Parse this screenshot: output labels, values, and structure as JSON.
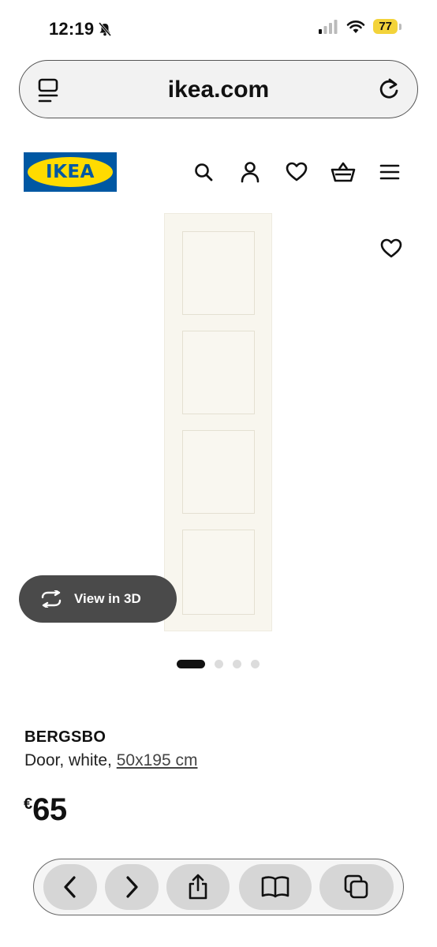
{
  "status_bar": {
    "time": "12:19",
    "battery": "77"
  },
  "browser": {
    "url": "ikea.com"
  },
  "header": {
    "logo_text": "IKEA",
    "nav_icons": [
      "search-icon",
      "account-icon",
      "heart-icon",
      "basket-icon",
      "menu-icon"
    ]
  },
  "gallery": {
    "view_3d_label": "View in 3D",
    "dot_count": 4,
    "active_dot": 1
  },
  "product": {
    "name": "BERGSBO",
    "description_prefix": "Door, white, ",
    "size_link": "50x195 cm",
    "currency": "€",
    "price": "65"
  },
  "colors": {
    "ikea_blue": "#0058a3",
    "ikea_yellow": "#ffdb00",
    "battery_yellow": "#f3d33a",
    "view3d_bg": "#4a4a4a"
  }
}
